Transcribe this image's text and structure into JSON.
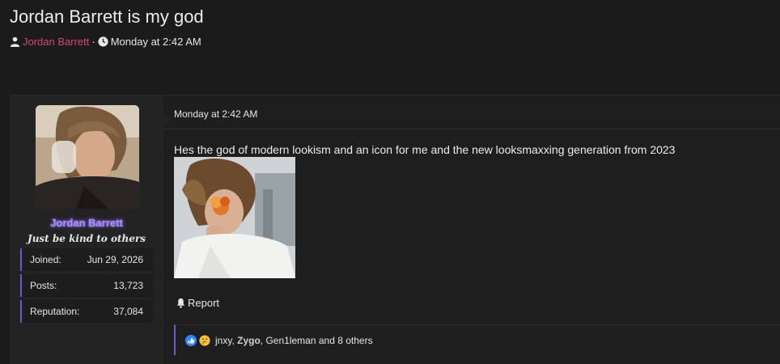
{
  "thread": {
    "title": "Jordan Barrett is my god",
    "author": "Jordan Barrett",
    "separator": "·",
    "time": "Monday at 2:42 AM"
  },
  "user": {
    "name": "Jordan Barrett",
    "title": "Just be kind to others",
    "stats": [
      {
        "label": "Joined:",
        "value": "Jun 29, 2026"
      },
      {
        "label": "Posts:",
        "value": "13,723"
      },
      {
        "label": "Reputation:",
        "value": "37,084"
      }
    ]
  },
  "post": {
    "date": "Monday at 2:42 AM",
    "text": "Hes the god of modern lookism and an icon for me and the new looksmaxxing generation from 2023",
    "report_label": "Report"
  },
  "reactions": {
    "icons": [
      "like-icon",
      "thinking-face-icon"
    ],
    "names": [
      "jnxy",
      "Zygo",
      "Gen1leman"
    ],
    "sep1": ", ",
    "sep2": ", ",
    "tail": " and 8 others"
  },
  "colors": {
    "author_link": "#d8437a",
    "username_glow": "#a88cf0",
    "accent_border": "#6a5acd",
    "background": "#1b1b1c"
  }
}
